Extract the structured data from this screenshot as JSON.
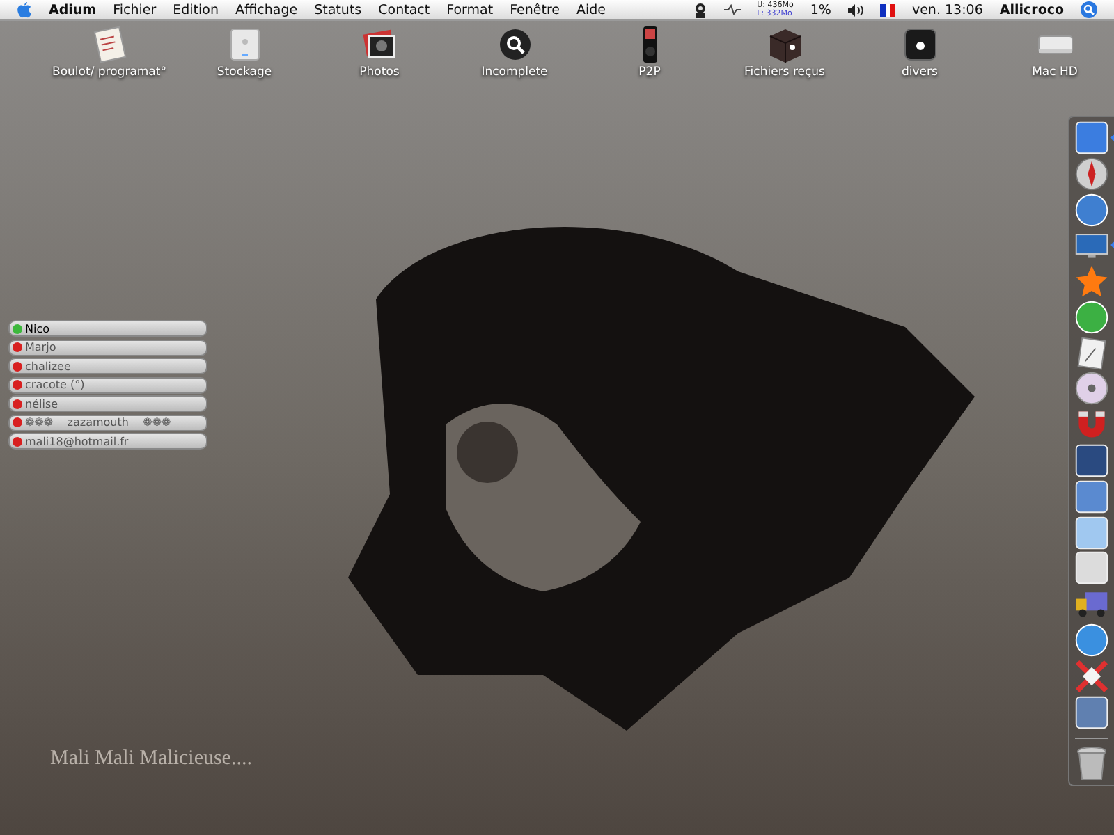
{
  "menu_bar": {
    "app": "Adium",
    "items": [
      "Fichier",
      "Edition",
      "Affichage",
      "Statuts",
      "Contact",
      "Format",
      "Fenêtre",
      "Aide"
    ],
    "memory_used": "U: 436Mo",
    "memory_free": "L: 332Mo",
    "cpu": "1%",
    "clock": "ven. 13:06",
    "user": "Allicroco"
  },
  "desktop_icons": [
    {
      "label": "Boulot/ programat°"
    },
    {
      "label": "Stockage"
    },
    {
      "label": "Photos"
    },
    {
      "label": "Incomplete"
    },
    {
      "label": "P2P"
    },
    {
      "label": "Fichiers reçus"
    },
    {
      "label": "divers"
    },
    {
      "label": "Mac HD"
    }
  ],
  "contacts": [
    {
      "name": "Nico",
      "online": true
    },
    {
      "name": "Marjo",
      "online": false
    },
    {
      "name": "chalizee",
      "online": false
    },
    {
      "name": "cracote (°)",
      "online": false
    },
    {
      "name": "nélise",
      "online": false
    },
    {
      "name": "❁❁❁    zazamouth    ❁❁❁",
      "online": false
    },
    {
      "name": "mali18@hotmail.fr",
      "online": false
    }
  ],
  "dock": [
    {
      "running": true
    },
    {
      "running": false
    },
    {
      "running": false
    },
    {
      "running": true
    },
    {
      "running": false
    },
    {
      "running": false
    },
    {
      "running": false
    },
    {
      "running": false
    },
    {
      "running": false
    },
    {
      "running": false
    },
    {
      "running": false
    },
    {
      "running": false
    },
    {
      "running": false
    },
    {
      "running": false
    },
    {
      "running": false
    },
    {
      "running": false
    },
    {
      "running": false
    }
  ],
  "caption": "Mali Mali Malicieuse...."
}
